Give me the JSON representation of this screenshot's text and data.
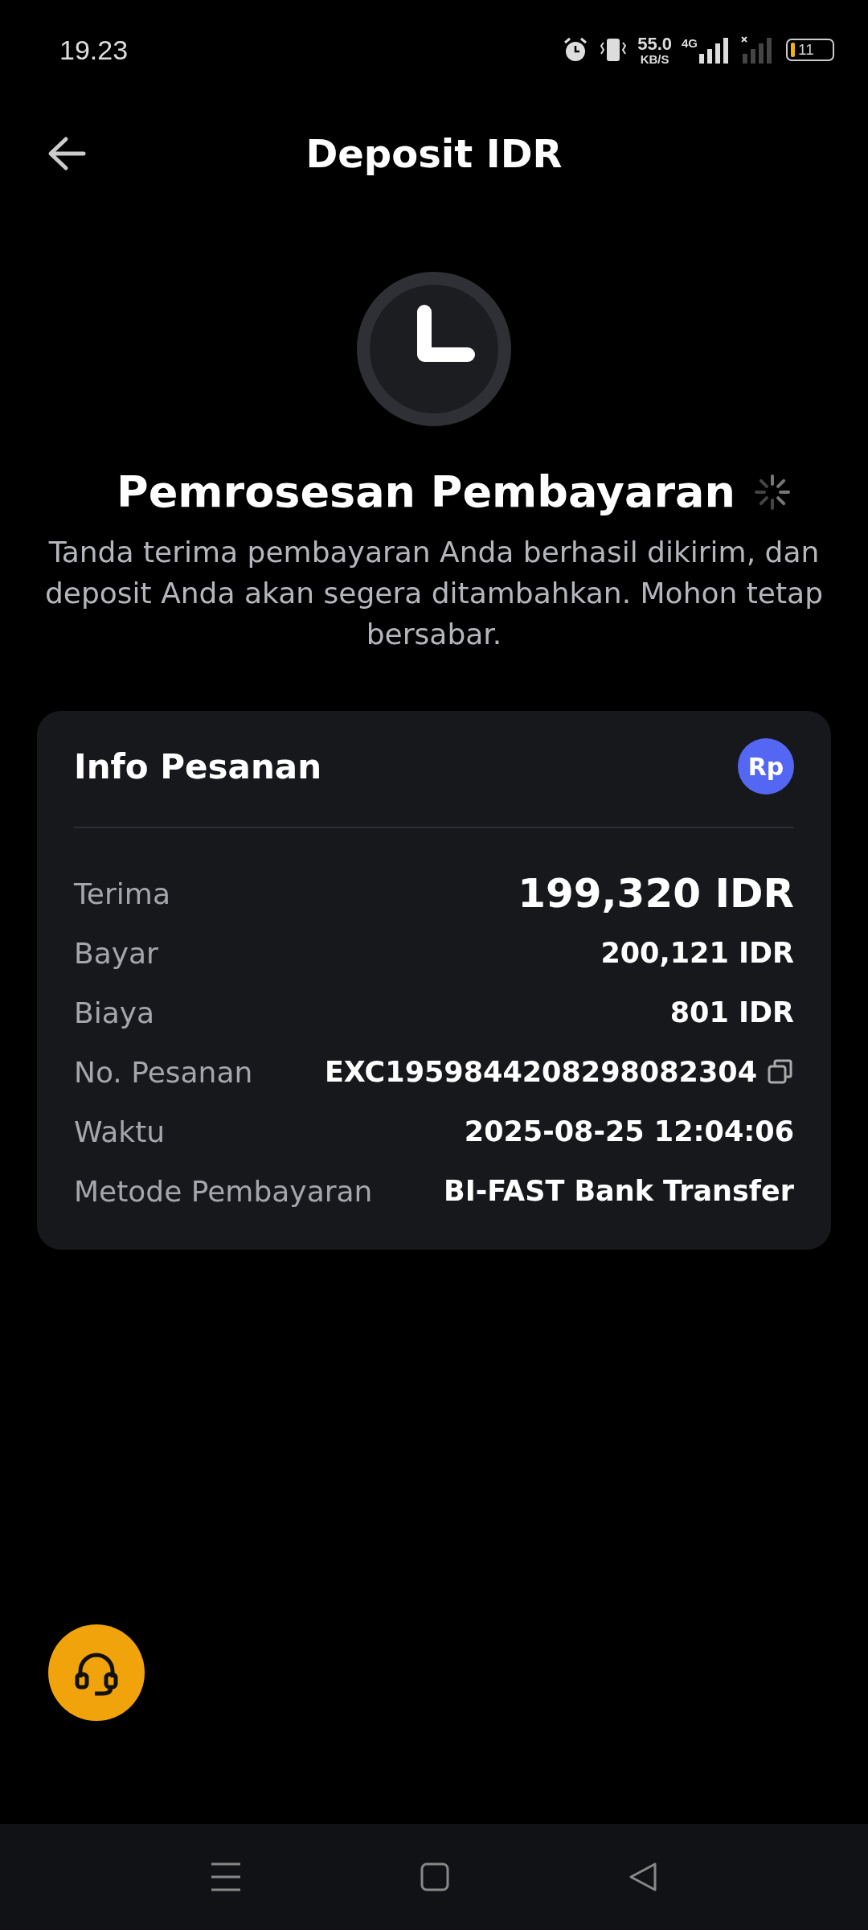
{
  "status_bar": {
    "time": "19.23",
    "speed": "55.0",
    "speed_unit": "KB/S",
    "network": "4G",
    "battery": "11"
  },
  "header": {
    "title": "Deposit IDR"
  },
  "status": {
    "title": "Pemrosesan Pembayaran",
    "message": "Tanda terima pembayaran Anda berhasil dikirim, dan deposit Anda akan segera ditambahkan. Mohon tetap bersabar."
  },
  "order_info": {
    "title": "Info Pesanan",
    "currency_badge": "Rp",
    "rows": [
      {
        "kind": "highlight",
        "label": "Terima",
        "value": "199,320 IDR"
      },
      {
        "kind": "plain",
        "label": "Bayar",
        "value": "200,121 IDR"
      },
      {
        "kind": "plain",
        "label": "Biaya",
        "value": "801 IDR"
      },
      {
        "kind": "copy",
        "label": "No. Pesanan",
        "value": "EXC1959844208298082304"
      },
      {
        "kind": "plain",
        "label": "Waktu",
        "value": "2025-08-25 12:04:06"
      },
      {
        "kind": "plain",
        "label": "Metode Pembayaran",
        "value": "BI-FAST Bank Transfer"
      }
    ]
  }
}
